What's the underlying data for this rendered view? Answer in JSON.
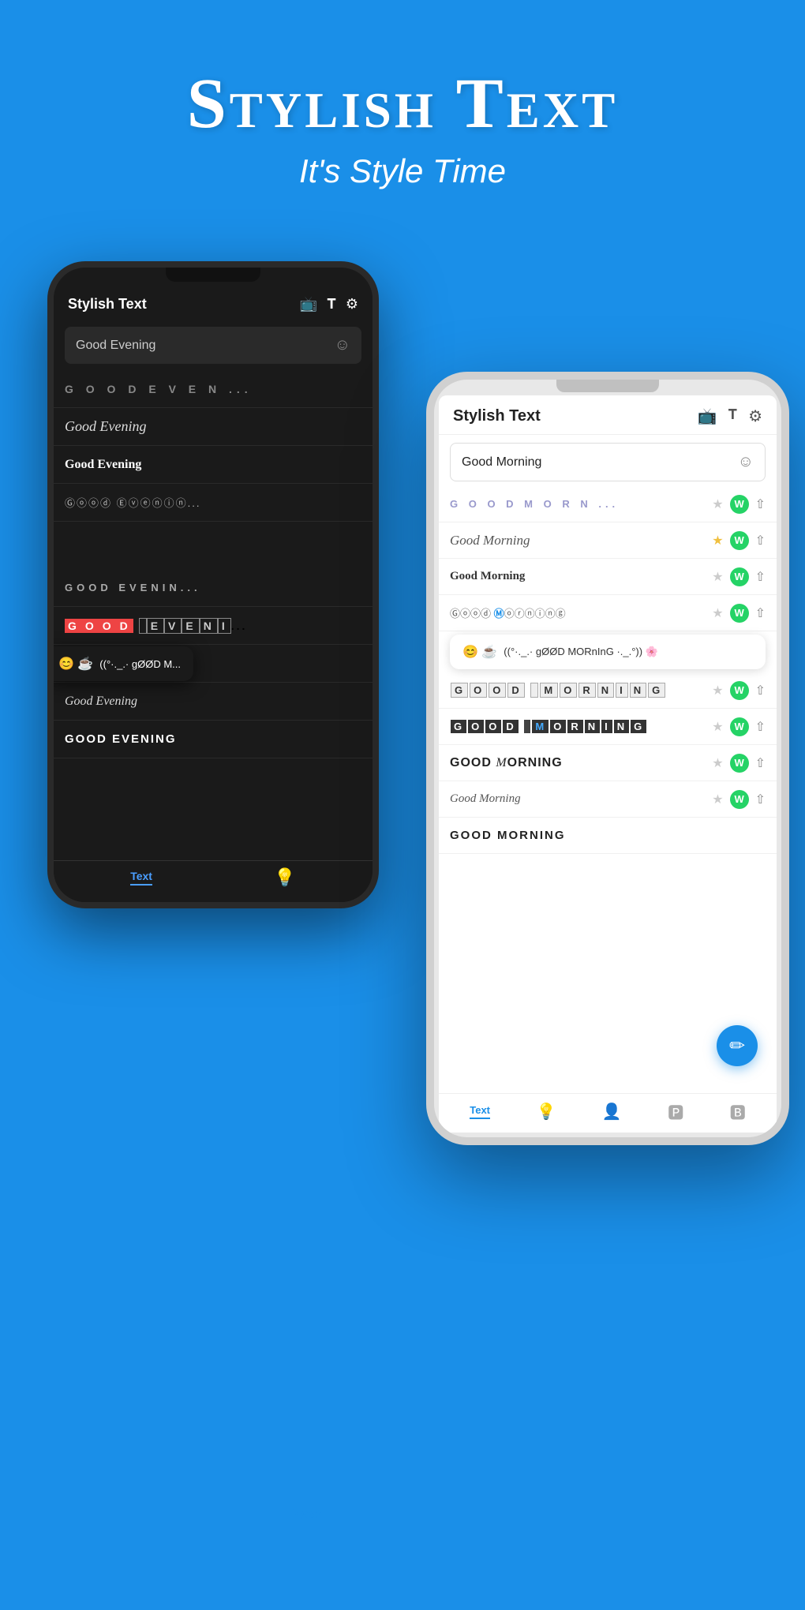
{
  "header": {
    "main_title": "Stylish Text",
    "sub_title": "It's Style Time"
  },
  "dark_phone": {
    "title": "Stylish Text",
    "input_text": "Good Evening",
    "emoji_placeholder": "☺",
    "rows": [
      {
        "text": "G O O D  E V E N ...",
        "style": "spaced"
      },
      {
        "text": "Good Evening",
        "style": "cursive"
      },
      {
        "text": "Good Evening",
        "style": "bold-serif"
      },
      {
        "text": "Ⓖⓞⓞⓓ Ⓔⓥⓔⓝⓘⓝ...",
        "style": "circle"
      },
      {
        "text": "😊 ☕ ((°·._.· gØØD M...",
        "style": "emoji-popup"
      },
      {
        "text": "GOOD EVENIN...",
        "style": "spaced-white"
      },
      {
        "text": "ＧＯＯＤ ＥＶＥＮＩ...",
        "style": "boxed-mixed"
      },
      {
        "text": "GOOD EVENIN...",
        "style": "large"
      },
      {
        "text": "Good Evening",
        "style": "elegant"
      },
      {
        "text": "GOOD EVENING",
        "style": "caps"
      }
    ],
    "bottom_tabs": [
      {
        "label": "Text",
        "active": true
      },
      {
        "icon": "🔆",
        "active": false
      }
    ]
  },
  "light_phone": {
    "title": "Stylish Text",
    "input_text": "Good Morning",
    "emoji_placeholder": "☺",
    "rows": [
      {
        "text": "G O O D  M O R N ...",
        "style": "spaced-blue",
        "star": "empty",
        "has_icons": true
      },
      {
        "text": "Good Morning",
        "style": "cursive",
        "star": "filled",
        "has_icons": true
      },
      {
        "text": "Good Morning",
        "style": "bold-serif",
        "star": "empty",
        "has_icons": true
      },
      {
        "text": "Ⓖⓞⓞⓓ Ⓜorning",
        "style": "circle",
        "star": "empty",
        "has_icons": true
      },
      {
        "text": "😊 ☕ ((°·._.· gØØD MORnInG ·._.°)) 🌸",
        "style": "emoji-popup"
      },
      {
        "text": "GOOD MORNING",
        "style": "boxed-white",
        "star": "empty",
        "has_icons": true
      },
      {
        "text": "ＧＯＯＤ ＭＯＲＮＩＮＧ",
        "style": "boxed-dark",
        "star": "empty",
        "has_icons": true
      },
      {
        "text": "GOOD MORNING",
        "style": "large",
        "star": "empty",
        "has_icons": true
      },
      {
        "text": "Good Morning",
        "style": "elegant",
        "star": "empty",
        "has_icons": true
      },
      {
        "text": "GOOD MORNING",
        "style": "caps",
        "star": "empty",
        "has_icons": false
      }
    ],
    "bottom_tabs": [
      {
        "label": "Text",
        "active": true
      },
      {
        "icon": "💡",
        "active": false
      },
      {
        "icon": "👤",
        "active": false
      },
      {
        "icon": "🅿",
        "active": false
      },
      {
        "icon": "🅱",
        "active": false
      }
    ],
    "fab_icon": "✏️"
  },
  "bottom_section": {
    "text_label": "Text"
  }
}
